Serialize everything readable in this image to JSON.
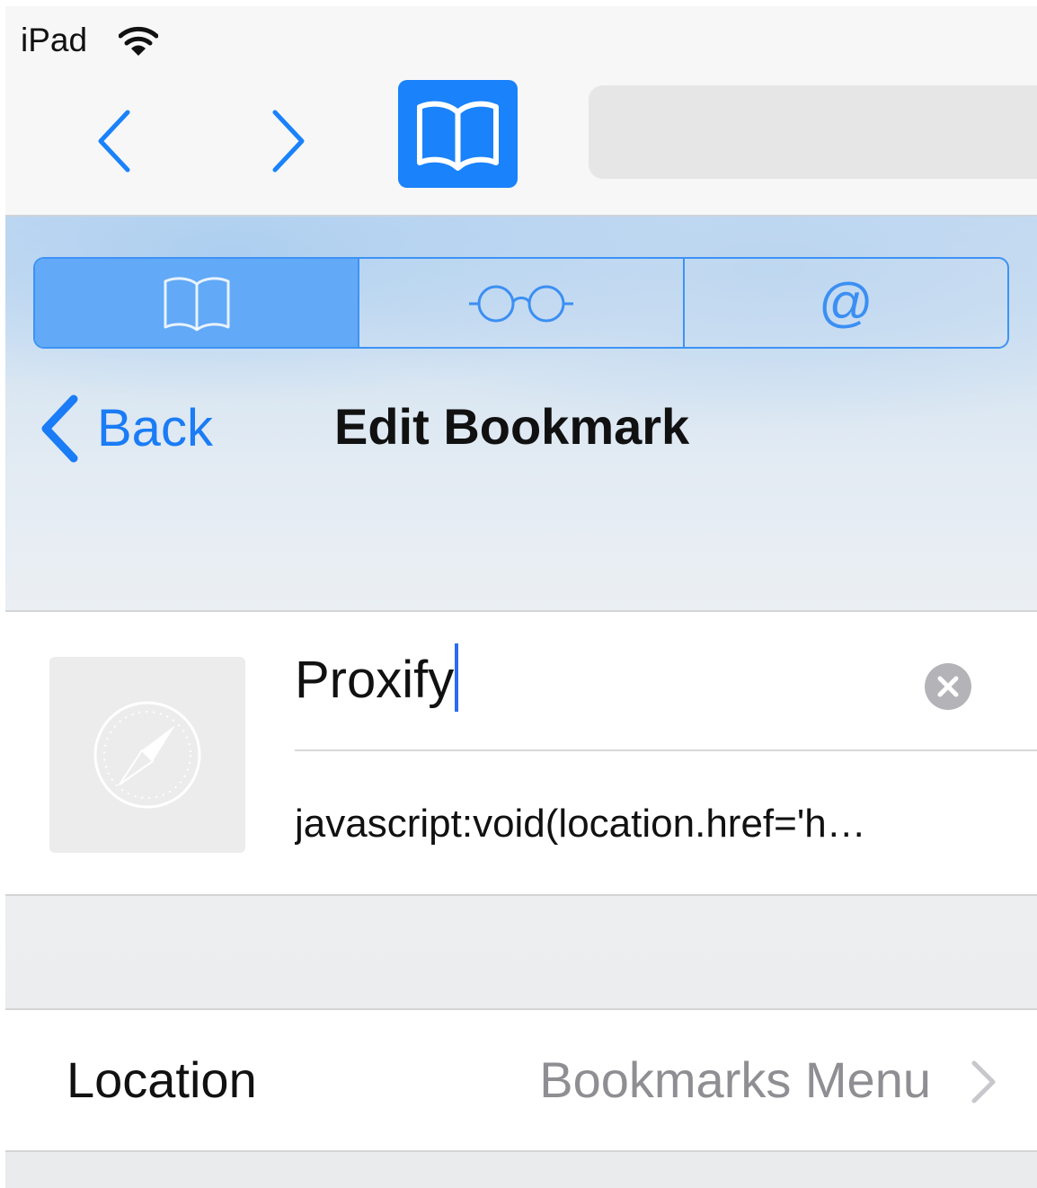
{
  "status_bar": {
    "carrier": "iPad",
    "wifi_icon": "wifi-icon"
  },
  "toolbar": {
    "back_icon": "chevron-left-icon",
    "forward_icon": "chevron-right-icon",
    "bookmarks_icon": "open-book-icon",
    "address_value": ""
  },
  "segments": [
    {
      "icon": "open-book-icon",
      "selected": true
    },
    {
      "icon": "reading-glasses-icon",
      "selected": false
    },
    {
      "label": "@",
      "icon": "at-sign-icon",
      "selected": false
    }
  ],
  "nav": {
    "back_label": "Back",
    "title": "Edit Bookmark"
  },
  "bookmark": {
    "thumbnail_icon": "compass-icon",
    "title_value": "Proxify",
    "url_value": "javascript:void(location.href='h…",
    "clear_icon": "clear-circle-icon"
  },
  "location": {
    "label": "Location",
    "value": "Bookmarks Menu",
    "disclosure_icon": "chevron-right-icon"
  },
  "colors": {
    "accent": "#1a82fb",
    "segment_selected": "#62a9f7",
    "secondary_text": "#8e8e93",
    "caret": "#2b6cf0"
  }
}
